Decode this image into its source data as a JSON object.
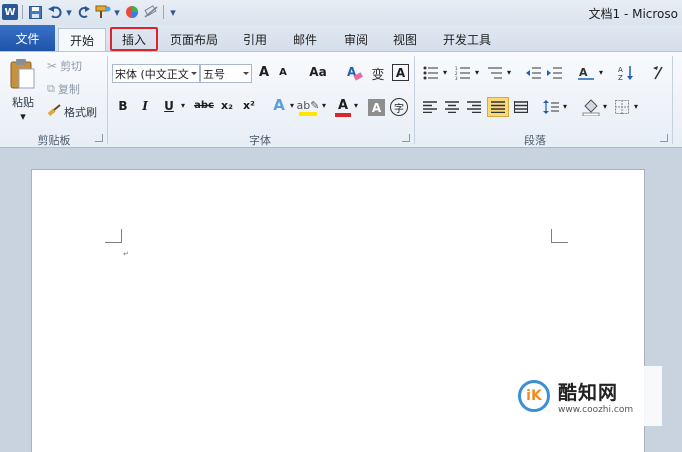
{
  "title_bar": {
    "window_title": "文档1 - Microso",
    "qat_icons": [
      "word-icon",
      "save-icon",
      "undo-icon",
      "redo-icon",
      "format-painter-icon",
      "color-icon",
      "eraser-icon",
      "customize-icon"
    ]
  },
  "tabs": {
    "file": "文件",
    "items": [
      {
        "label": "开始",
        "active": true
      },
      {
        "label": "插入",
        "highlighted": true
      },
      {
        "label": "页面布局"
      },
      {
        "label": "引用"
      },
      {
        "label": "邮件"
      },
      {
        "label": "审阅"
      },
      {
        "label": "视图"
      },
      {
        "label": "开发工具"
      }
    ]
  },
  "clipboard": {
    "paste": "粘贴",
    "cut": "剪切",
    "copy": "复制",
    "format_painter": "格式刷",
    "group_label": "剪贴板"
  },
  "font": {
    "font_name": "宋体 (中文正文",
    "font_size": "五号",
    "grow": "A",
    "shrink": "A",
    "change_case": "Aa",
    "clear_format": "A",
    "phonetic": "变",
    "border_char": "A",
    "bold": "B",
    "italic": "I",
    "underline": "U",
    "strikethrough": "abc",
    "subscript": "x₂",
    "superscript": "x²",
    "text_effects": "A",
    "font_color": "A",
    "char_shading": "A",
    "enclosed": "字",
    "group_label": "字体"
  },
  "paragraph": {
    "group_label": "段落"
  },
  "watermark": {
    "logo_glyph": "iK",
    "name": "酷知网",
    "url": "www.coozhi.com"
  },
  "colors": {
    "file_tab": "#2a5ea8",
    "highlight_border": "#d9262d",
    "font_color_bar": "#d9262d",
    "highlight_bar": "#ffe600"
  }
}
